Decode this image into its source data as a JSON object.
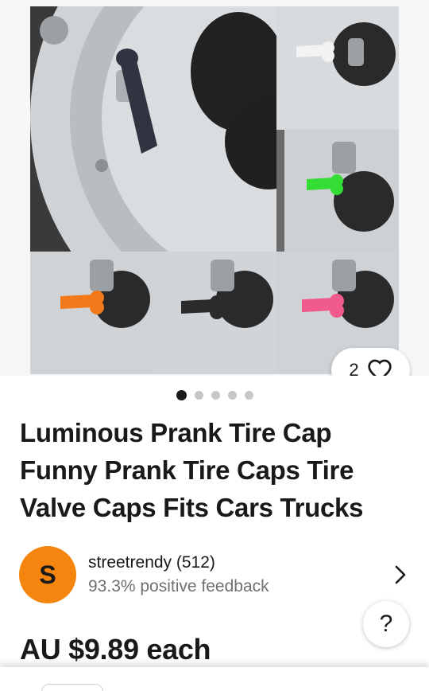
{
  "gallery": {
    "favorite_count": "2",
    "dot_count": 5,
    "active_dot": 0,
    "cap_colors": [
      "#2f3440",
      "#f2f2f2",
      "#33dd33",
      "#f27a1a",
      "#2b2b2b",
      "#f05a8c"
    ]
  },
  "product": {
    "title": "Luminous Prank Tire Cap Funny Prank Tire Caps Tire Valve Caps Fits Cars Trucks",
    "price": "AU $9.89 each"
  },
  "seller": {
    "avatar_letter": "S",
    "name": "streetrendy (512)",
    "feedback": "93.3% positive feedback",
    "avatar_color": "#f5850f"
  },
  "help": {
    "label": "?"
  },
  "icons": [
    "heart-icon",
    "chevron-right-icon",
    "help-icon"
  ]
}
